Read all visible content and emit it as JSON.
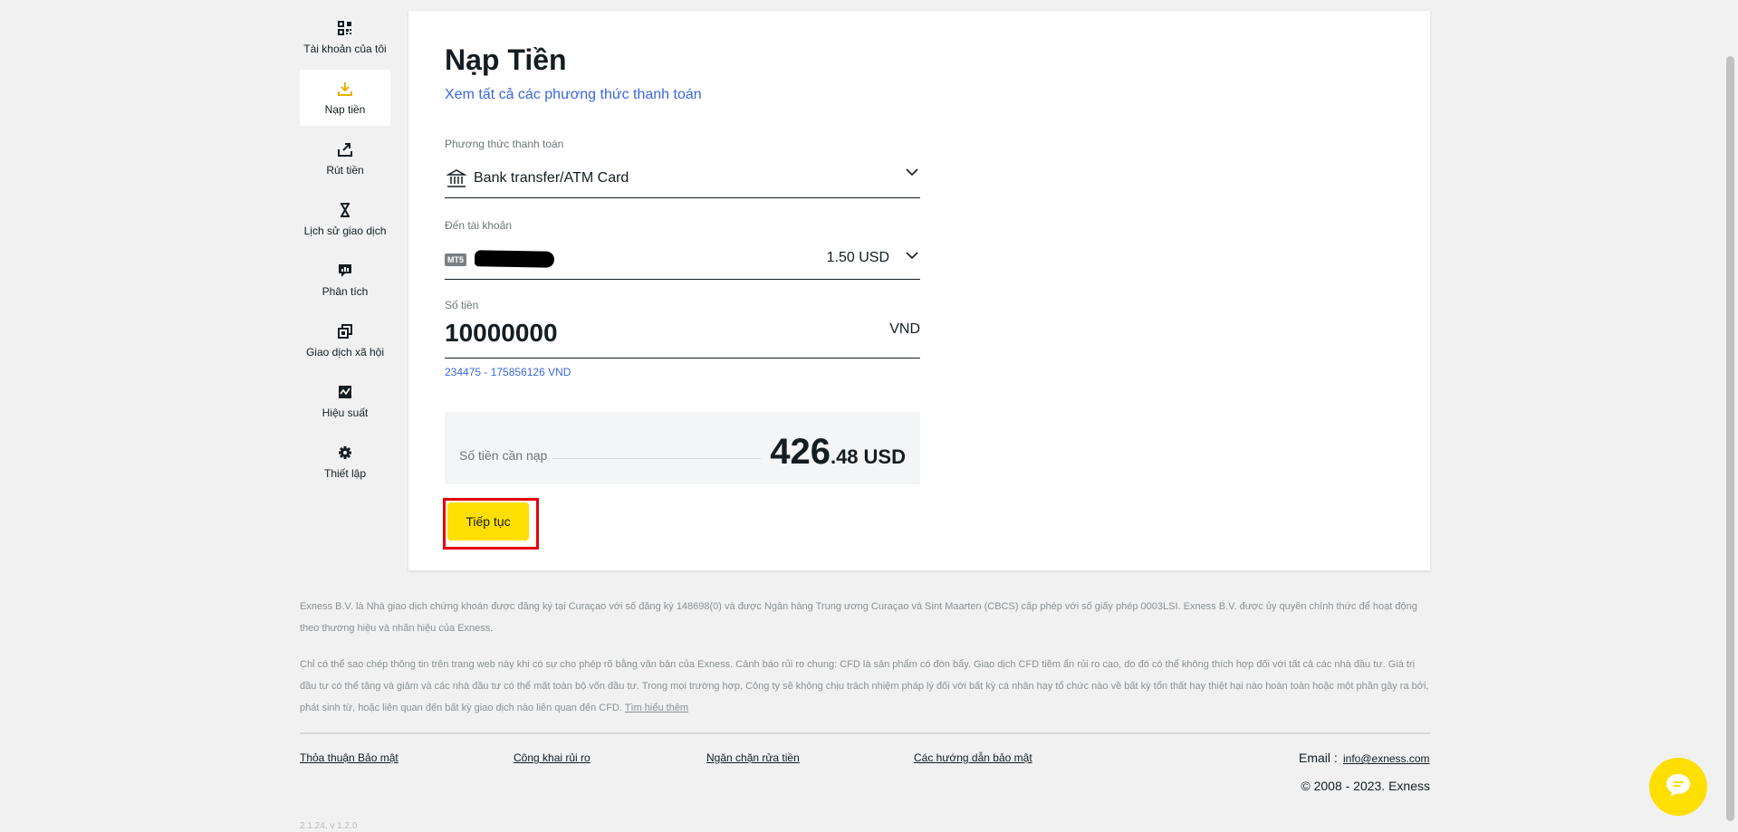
{
  "sidebar": {
    "items": [
      {
        "label": "Tài khoản của tôi",
        "icon": "dashboard-icon"
      },
      {
        "label": "Nạp tiền",
        "icon": "deposit-icon",
        "active": true
      },
      {
        "label": "Rút tiền",
        "icon": "withdraw-icon"
      },
      {
        "label": "Lịch sử giao dịch",
        "icon": "hourglass-icon"
      },
      {
        "label": "Phân tích",
        "icon": "analytics-icon"
      },
      {
        "label": "Giao dịch xã hội",
        "icon": "social-trading-icon"
      },
      {
        "label": "Hiệu suất",
        "icon": "performance-icon"
      },
      {
        "label": "Thiết lập",
        "icon": "gear-icon"
      }
    ]
  },
  "main": {
    "title": "Nạp Tiền",
    "view_all_link": "Xem tất cả các phương thức thanh toán",
    "payment_method": {
      "label": "Phương thức thanh toán",
      "value": "Bank transfer/ATM Card",
      "icon": "bank-icon"
    },
    "to_account": {
      "label": "Đến tài khoản",
      "badge": "MT5",
      "balance": "1.50 USD"
    },
    "amount": {
      "label": "Số tiền",
      "value": "10000000",
      "currency": "VND",
      "range": "234475 - 175856126 VND"
    },
    "summary": {
      "label": "Số tiền cần nạp",
      "integer": "426",
      "decimal": ".48",
      "currency": "USD"
    },
    "continue_button": "Tiếp tục"
  },
  "footer": {
    "disclaimer_1": "Exness B.V. là Nhà giao dịch chứng khoán được đăng ký tại Curaçao với số đăng ký 148698(0) và được Ngân hàng Trung ương Curaçao và Sint Maarten (CBCS) cấp phép với số giấy phép 0003LSI. Exness B.V. được ủy quyền chính thức để hoạt động theo thương hiệu và nhãn hiệu của Exness.",
    "disclaimer_2": "Chỉ có thể sao chép thông tin trên trang web này khi có sự cho phép rõ bằng văn bản của Exness. Cảnh báo rủi ro chung: CFD là sản phẩm có đòn bẩy. Giao dịch CFD tiềm ẩn rủi ro cao, do đó có thể không thích hợp đối với tất cả các nhà đầu tư. Giá trị đầu tư có thể tăng và giảm và các nhà đầu tư có thể mất toàn bộ vốn đầu tư. Trong mọi trường hợp, Công ty sẽ không chịu trách nhiệm pháp lý đối với bất kỳ cá nhân hay tổ chức nào về bất kỳ tổn thất hay thiệt hại nào hoàn toàn hoặc một phần gây ra bởi, phát sinh từ, hoặc liên quan đến bất kỳ giao dịch nào liên quan đến CFD.",
    "learn_more": "Tìm hiểu thêm",
    "links": [
      "Thỏa thuận Bảo mật",
      "Công khai rủi ro",
      "Ngăn chặn rửa tiền",
      "Các hướng dẫn bảo mật"
    ],
    "email_label": "Email :",
    "email": "info@exness.com",
    "copyright": "© 2008 - 2023. Exness",
    "version": "2.1.24, v 1.2.0"
  },
  "colors": {
    "accent": "#ffde02",
    "link": "#3b67e0",
    "highlight": "#e3000b"
  }
}
